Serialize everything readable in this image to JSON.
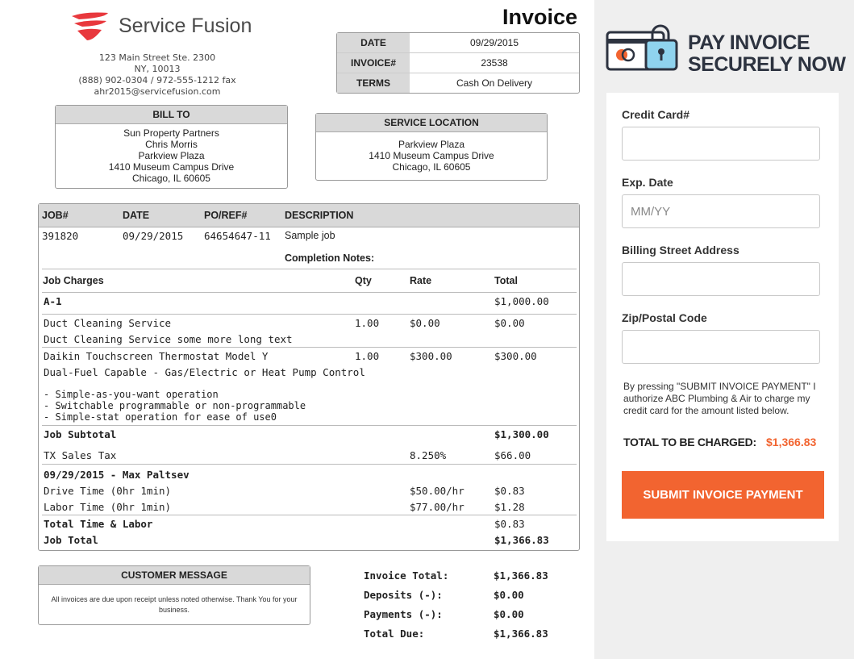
{
  "company": {
    "name": "Service Fusion",
    "address1": "123 Main Street Ste. 2300",
    "address2": "NY, 10013",
    "phone": "(888) 902-0304 / 972-555-1212 fax",
    "email": "ahr2015@servicefusion.com"
  },
  "invoice_title": "Invoice",
  "meta": [
    {
      "label": "DATE",
      "value": "09/29/2015"
    },
    {
      "label": "INVOICE#",
      "value": "23538"
    },
    {
      "label": "TERMS",
      "value": "Cash On Delivery"
    }
  ],
  "bill_to": {
    "heading": "BILL TO",
    "lines": [
      "Sun Property Partners",
      "Chris Morris",
      "Parkview Plaza",
      "1410 Museum Campus Drive",
      "Chicago, IL 60605"
    ]
  },
  "service_location": {
    "heading": "SERVICE LOCATION",
    "lines": [
      "Parkview Plaza",
      "1410 Museum Campus Drive",
      "Chicago, IL 60605"
    ]
  },
  "job": {
    "headers": [
      "JOB#",
      "DATE",
      "PO/REF#",
      "DESCRIPTION"
    ],
    "values": [
      "391820",
      "09/29/2015",
      "64654647-11",
      "Sample job"
    ],
    "completion_notes": "Completion Notes:",
    "charges_headers": [
      "Job Charges",
      "Qty",
      "Rate",
      "Total"
    ],
    "group": "A-1",
    "group_total": "$1,000.00",
    "item1_name": "Duct Cleaning Service",
    "item1_qty": "1.00",
    "item1_rate": "$0.00",
    "item1_total": "$0.00",
    "item1_desc": "Duct Cleaning Service some more long text",
    "item2_name": "Daikin Touchscreen Thermostat Model Y",
    "item2_qty": "1.00",
    "item2_rate": "$300.00",
    "item2_total": "$300.00",
    "item2_desc": "Dual-Fuel Capable - Gas/Electric or Heat Pump Control",
    "item2_bullets": [
      "- Simple-as-you-want operation",
      "- Switchable programmable or non-programmable",
      "- Simple-stat operation for ease of use0"
    ],
    "subtotal_label": "Job Subtotal",
    "subtotal": "$1,300.00",
    "tax_label": "TX Sales Tax",
    "tax_rate": "8.250%",
    "tax": "$66.00",
    "tech_heading": "09/29/2015 - Max Paltsev",
    "drive_label": "Drive Time (0hr 1min)",
    "drive_rate": "$50.00/hr",
    "drive_total": "$0.83",
    "labor_label": "Labor Time (0hr 1min)",
    "labor_rate": "$77.00/hr",
    "labor_total": "$1.28",
    "total_time_label": "Total Time & Labor",
    "total_time": "$0.83",
    "job_total_label": "Job Total",
    "job_total": "$1,366.83"
  },
  "customer_message": {
    "heading": "CUSTOMER MESSAGE",
    "text": "All invoices are due upon receipt unless noted otherwise. Thank You for your business."
  },
  "totals": [
    {
      "label": "Invoice Total:",
      "value": "$1,366.83"
    },
    {
      "label": "Deposits (-):",
      "value": "$0.00"
    },
    {
      "label": "Payments (-):",
      "value": "$0.00"
    },
    {
      "label": "Total Due:",
      "value": "$1,366.83"
    }
  ],
  "pay": {
    "title_line1": "PAY INVOICE",
    "title_line2": "SECURELY NOW",
    "cc_label": "Credit Card#",
    "cc_value": "",
    "exp_label": "Exp. Date",
    "exp_placeholder": "MM/YY",
    "street_label": "Billing Street Address",
    "street_value": "",
    "zip_label": "Zip/Postal Code",
    "zip_value": "",
    "disclaimer": "By pressing \"SUBMIT INVOICE PAYMENT\" I authorize ABC Plumbing & Air to charge my credit card for the amount listed below.",
    "total_label": "TOTAL TO BE CHARGED:",
    "total_value": "$1,366.83",
    "submit_label": "SUBMIT INVOICE PAYMENT",
    "accent_color": "#f26430",
    "icon": "card-lock-icon"
  }
}
